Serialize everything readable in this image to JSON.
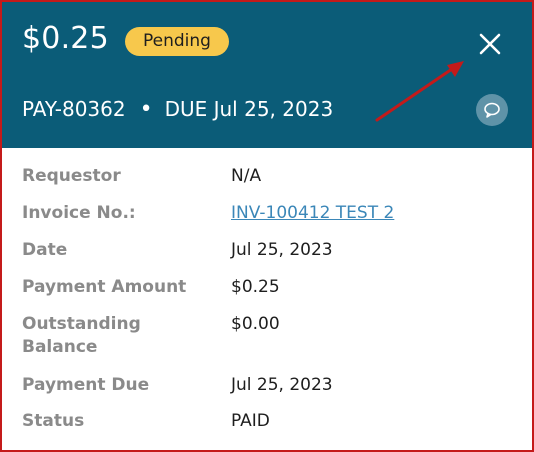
{
  "header": {
    "amount": "$0.25",
    "status_badge": "Pending",
    "payment_id": "PAY-80362",
    "separator": "•",
    "due_text": "DUE Jul 25, 2023",
    "close_icon": "close-icon",
    "comment_icon": "speech-bubble-icon",
    "background_color": "#0b5c78",
    "badge_color": "#f7c84c"
  },
  "annotation": {
    "arrow_color": "#c41a1a",
    "frame_color": "#c41a1a"
  },
  "details": {
    "rows": [
      {
        "label": "Requestor",
        "value": "N/A"
      },
      {
        "label": "Invoice No.:",
        "value": "INV-100412 TEST 2"
      },
      {
        "label": "Date",
        "value": "Jul 25, 2023"
      },
      {
        "label": "Payment Amount",
        "value": "$0.25"
      },
      {
        "label": "Outstanding Balance",
        "value": "$0.00"
      },
      {
        "label": "Payment Due",
        "value": "Jul 25, 2023"
      },
      {
        "label": "Status",
        "value": "PAID"
      }
    ],
    "link_color": "#3b87b8",
    "label_color": "#8a8a8a"
  }
}
